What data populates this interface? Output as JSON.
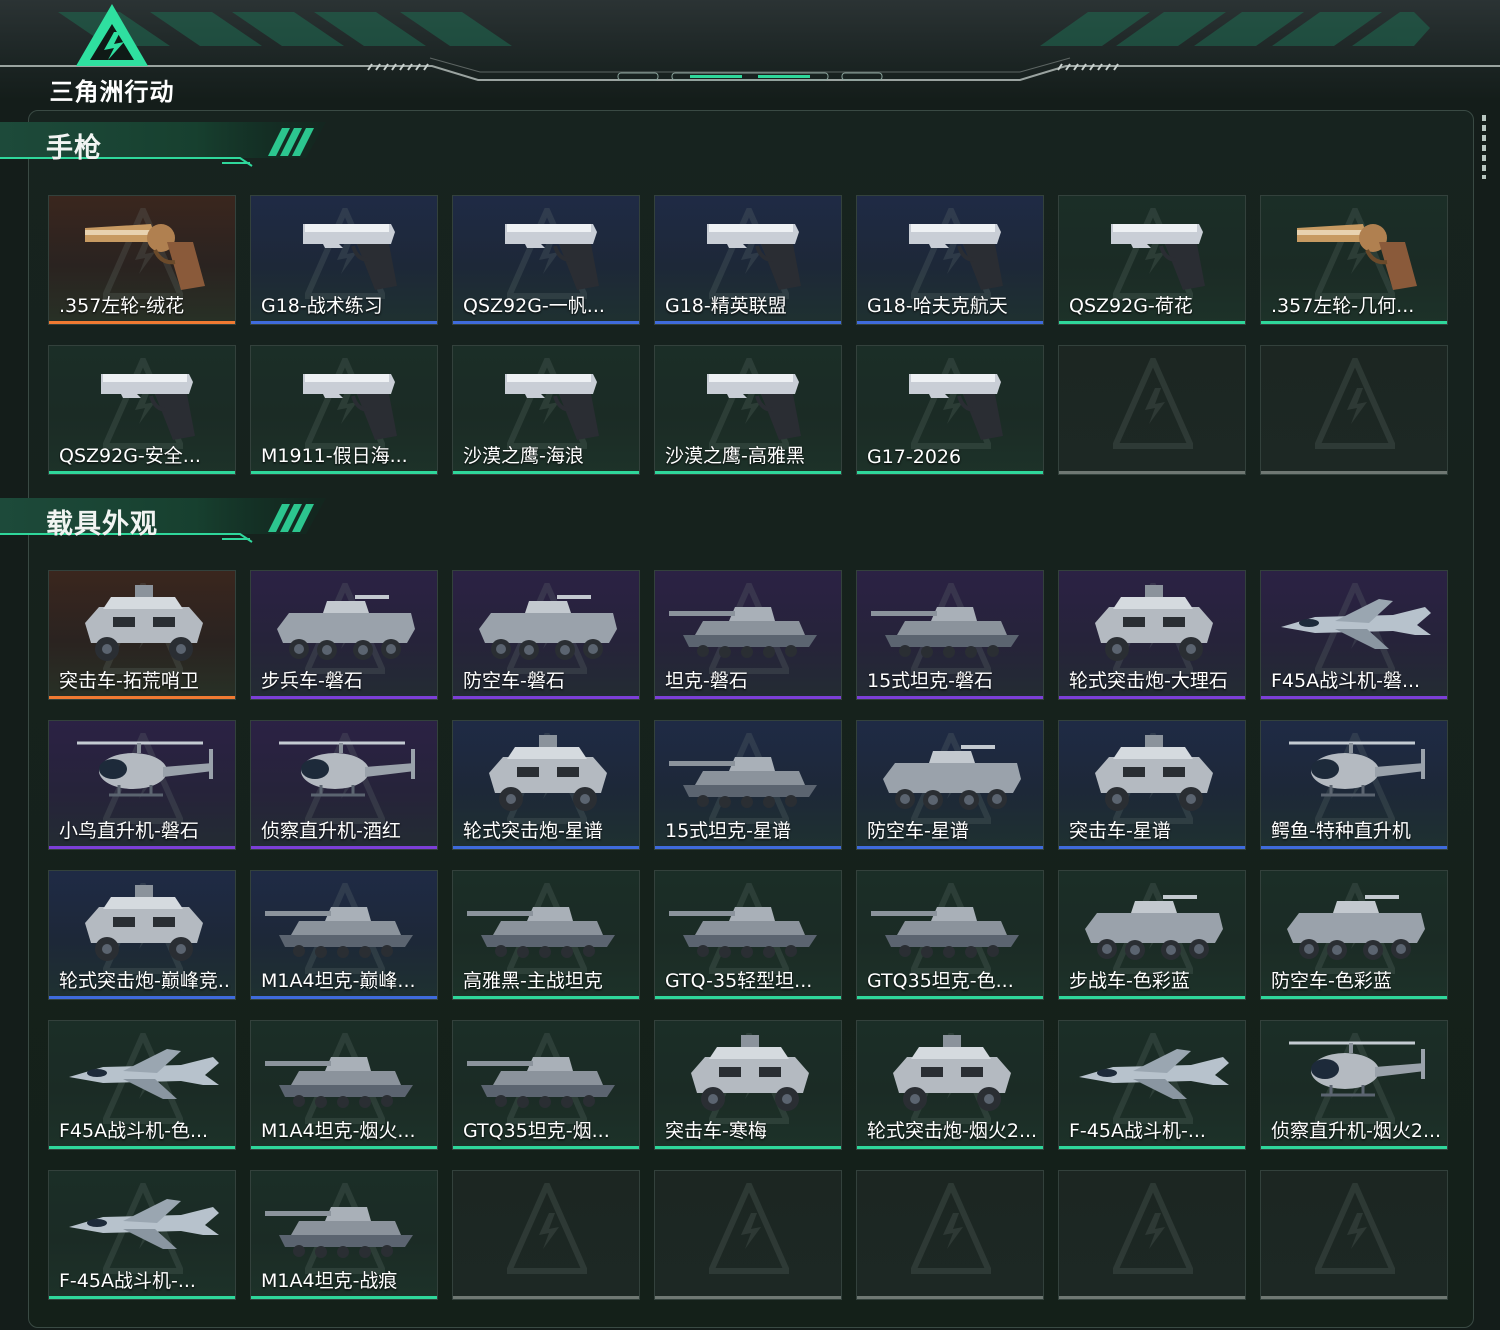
{
  "app": {
    "title": "三角洲行动"
  },
  "colors": {
    "accent": "#2fd79b",
    "rarity_orange": "#f07a32",
    "rarity_blue": "#3f6bdc",
    "rarity_purple": "#7c3fd8",
    "rarity_green": "#2fd79b",
    "rarity_empty": "#6f7873"
  },
  "sections": [
    {
      "title": "手枪",
      "items": [
        {
          "name": ".357左轮-绒花",
          "rarity": "orange",
          "icon": "revolver-icon"
        },
        {
          "name": "G18-战术练习",
          "rarity": "blue",
          "icon": "pistol-icon"
        },
        {
          "name": "QSZ92G-一帆...",
          "rarity": "blue",
          "icon": "pistol-icon"
        },
        {
          "name": "G18-精英联盟",
          "rarity": "blue",
          "icon": "pistol-icon"
        },
        {
          "name": "G18-哈夫克航天",
          "rarity": "blue",
          "icon": "pistol-icon"
        },
        {
          "name": "QSZ92G-荷花",
          "rarity": "green",
          "icon": "pistol-icon"
        },
        {
          "name": ".357左轮-几何...",
          "rarity": "green",
          "icon": "revolver-icon"
        },
        {
          "name": "QSZ92G-安全...",
          "rarity": "green",
          "icon": "pistol-icon"
        },
        {
          "name": "M1911-假日海...",
          "rarity": "green",
          "icon": "pistol-icon"
        },
        {
          "name": "沙漠之鹰-海浪",
          "rarity": "green",
          "icon": "pistol-icon"
        },
        {
          "name": "沙漠之鹰-高雅黑",
          "rarity": "green",
          "icon": "pistol-icon"
        },
        {
          "name": "G17-2026",
          "rarity": "green",
          "icon": "pistol-icon"
        },
        {
          "name": "",
          "rarity": "empty",
          "icon": ""
        },
        {
          "name": "",
          "rarity": "empty",
          "icon": ""
        }
      ]
    },
    {
      "title": "载具外观",
      "items": [
        {
          "name": "突击车-拓荒哨卫",
          "rarity": "orange",
          "icon": "armored-car-icon"
        },
        {
          "name": "步兵车-磐石",
          "rarity": "purple",
          "icon": "ifv-icon"
        },
        {
          "name": "防空车-磐石",
          "rarity": "purple",
          "icon": "ifv-icon"
        },
        {
          "name": "坦克-磐石",
          "rarity": "purple",
          "icon": "tank-icon"
        },
        {
          "name": "15式坦克-磐石",
          "rarity": "purple",
          "icon": "tank-icon"
        },
        {
          "name": "轮式突击炮-大理石",
          "rarity": "purple",
          "icon": "armored-car-icon"
        },
        {
          "name": "F45A战斗机-磐...",
          "rarity": "purple",
          "icon": "jet-icon"
        },
        {
          "name": "小鸟直升机-磐石",
          "rarity": "purple",
          "icon": "helicopter-icon"
        },
        {
          "name": "侦察直升机-酒红",
          "rarity": "purple",
          "icon": "helicopter-icon"
        },
        {
          "name": "轮式突击炮-星谱",
          "rarity": "blue",
          "icon": "armored-car-icon"
        },
        {
          "name": "15式坦克-星谱",
          "rarity": "blue",
          "icon": "tank-icon"
        },
        {
          "name": "防空车-星谱",
          "rarity": "blue",
          "icon": "ifv-icon"
        },
        {
          "name": "突击车-星谱",
          "rarity": "blue",
          "icon": "armored-car-icon"
        },
        {
          "name": "鳄鱼-特种直升机",
          "rarity": "blue",
          "icon": "helicopter-icon"
        },
        {
          "name": "轮式突击炮-巅峰竞...",
          "rarity": "blue",
          "icon": "armored-car-icon"
        },
        {
          "name": "M1A4坦克-巅峰...",
          "rarity": "blue",
          "icon": "tank-icon"
        },
        {
          "name": "高雅黑-主战坦克",
          "rarity": "green",
          "icon": "tank-icon"
        },
        {
          "name": "GTQ-35轻型坦...",
          "rarity": "green",
          "icon": "tank-icon"
        },
        {
          "name": "GTQ35坦克-色...",
          "rarity": "green",
          "icon": "tank-icon"
        },
        {
          "name": "步战车-色彩蓝",
          "rarity": "green",
          "icon": "ifv-icon"
        },
        {
          "name": "防空车-色彩蓝",
          "rarity": "green",
          "icon": "ifv-icon"
        },
        {
          "name": "F45A战斗机-色...",
          "rarity": "green",
          "icon": "jet-icon"
        },
        {
          "name": "M1A4坦克-烟火...",
          "rarity": "green",
          "icon": "tank-icon"
        },
        {
          "name": "GTQ35坦克-烟...",
          "rarity": "green",
          "icon": "tank-icon"
        },
        {
          "name": "突击车-寒梅",
          "rarity": "green",
          "icon": "armored-car-icon"
        },
        {
          "name": "轮式突击炮-烟火2...",
          "rarity": "green",
          "icon": "armored-car-icon"
        },
        {
          "name": "F-45A战斗机-...",
          "rarity": "green",
          "icon": "jet-icon"
        },
        {
          "name": "侦察直升机-烟火2...",
          "rarity": "green",
          "icon": "helicopter-icon"
        },
        {
          "name": "F-45A战斗机-...",
          "rarity": "green",
          "icon": "jet-icon"
        },
        {
          "name": "M1A4坦克-战痕",
          "rarity": "green",
          "icon": "tank-icon"
        },
        {
          "name": "",
          "rarity": "empty",
          "icon": ""
        },
        {
          "name": "",
          "rarity": "empty",
          "icon": ""
        },
        {
          "name": "",
          "rarity": "empty",
          "icon": ""
        },
        {
          "name": "",
          "rarity": "empty",
          "icon": ""
        },
        {
          "name": "",
          "rarity": "empty",
          "icon": ""
        }
      ]
    }
  ]
}
